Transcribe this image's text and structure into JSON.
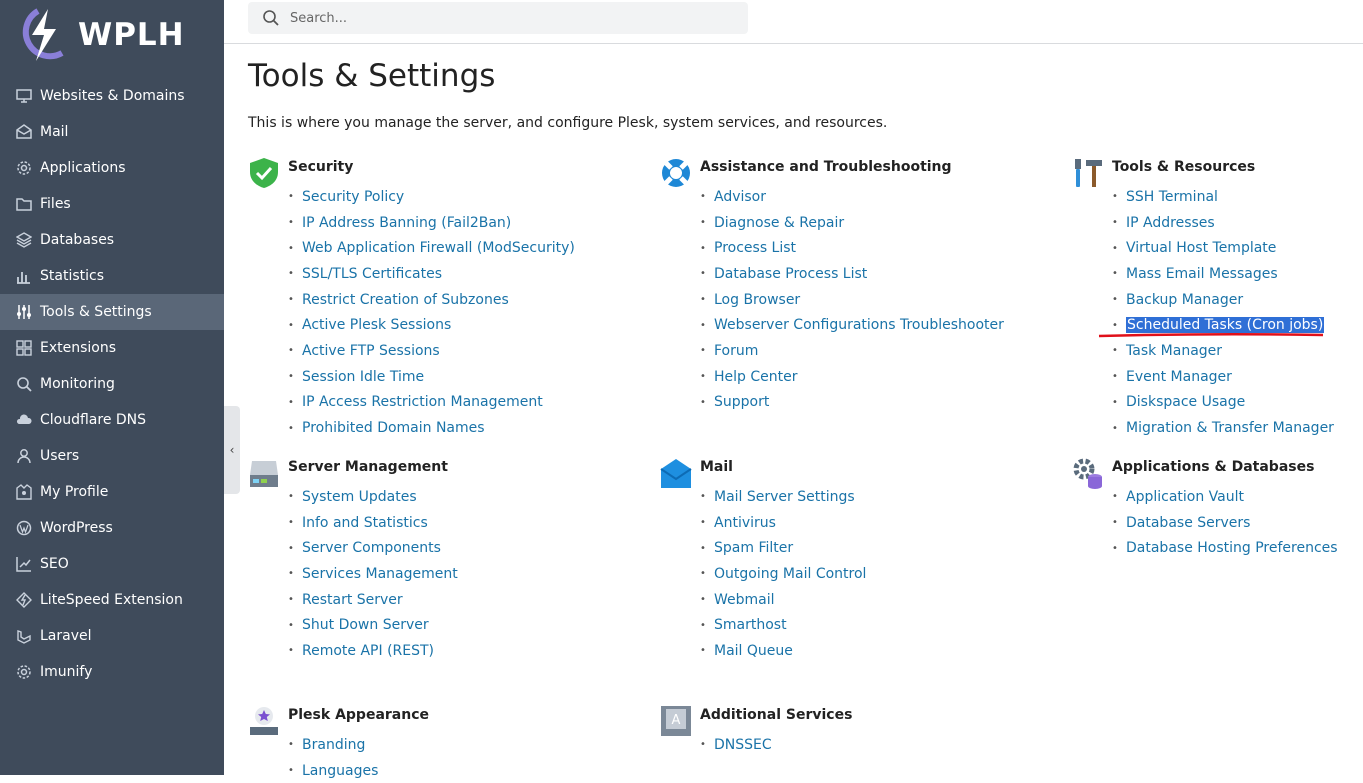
{
  "brand": {
    "name": "WPLH"
  },
  "search": {
    "placeholder": "Search..."
  },
  "sidebar": {
    "items": [
      {
        "label": "Websites & Domains",
        "icon": "monitor-icon"
      },
      {
        "label": "Mail",
        "icon": "mail-icon"
      },
      {
        "label": "Applications",
        "icon": "gear-icon"
      },
      {
        "label": "Files",
        "icon": "folder-icon"
      },
      {
        "label": "Databases",
        "icon": "layers-icon"
      },
      {
        "label": "Statistics",
        "icon": "bar-chart-icon"
      },
      {
        "label": "Tools & Settings",
        "icon": "sliders-icon",
        "active": true
      },
      {
        "label": "Extensions",
        "icon": "grid-icon"
      },
      {
        "label": "Monitoring",
        "icon": "magnifier-icon"
      },
      {
        "label": "Cloudflare DNS",
        "icon": "cloud-icon"
      },
      {
        "label": "Users",
        "icon": "user-icon"
      },
      {
        "label": "My Profile",
        "icon": "profile-icon"
      },
      {
        "label": "WordPress",
        "icon": "wordpress-icon"
      },
      {
        "label": "SEO",
        "icon": "seo-chart-icon"
      },
      {
        "label": "LiteSpeed Extension",
        "icon": "litespeed-icon"
      },
      {
        "label": "Laravel",
        "icon": "laravel-icon"
      },
      {
        "label": "Imunify",
        "icon": "shield-gear-icon"
      }
    ]
  },
  "page": {
    "title": "Tools & Settings",
    "description": "This is where you manage the server, and configure Plesk, system services, and resources."
  },
  "sections": {
    "security": {
      "title": "Security",
      "links": [
        "Security Policy",
        "IP Address Banning (Fail2Ban)",
        "Web Application Firewall (ModSecurity)",
        "SSL/TLS Certificates",
        "Restrict Creation of Subzones",
        "Active Plesk Sessions",
        "Active FTP Sessions",
        "Session Idle Time",
        "IP Access Restriction Management",
        "Prohibited Domain Names"
      ]
    },
    "assistance": {
      "title": "Assistance and Troubleshooting",
      "links": [
        "Advisor",
        "Diagnose & Repair",
        "Process List",
        "Database Process List",
        "Log Browser",
        "Webserver Configurations Troubleshooter",
        "Forum",
        "Help Center",
        "Support"
      ]
    },
    "tools": {
      "title": "Tools & Resources",
      "links": [
        "SSH Terminal",
        "IP Addresses",
        "Virtual Host Template",
        "Mass Email Messages",
        "Backup Manager",
        "Scheduled Tasks (Cron jobs)",
        "Task Manager",
        "Event Manager",
        "Diskspace Usage",
        "Migration & Transfer Manager"
      ],
      "selected": "Scheduled Tasks (Cron jobs)"
    },
    "server": {
      "title": "Server Management",
      "links": [
        "System Updates",
        "Info and Statistics",
        "Server Components",
        "Services Management",
        "Restart Server",
        "Shut Down Server",
        "Remote API (REST)"
      ]
    },
    "mail": {
      "title": "Mail",
      "links": [
        "Mail Server Settings",
        "Antivirus",
        "Spam Filter",
        "Outgoing Mail Control",
        "Webmail",
        "Smarthost",
        "Mail Queue"
      ]
    },
    "appsdb": {
      "title": "Applications & Databases",
      "links": [
        "Application Vault",
        "Database Servers",
        "Database Hosting Preferences"
      ]
    },
    "appearance": {
      "title": "Plesk Appearance",
      "links": [
        "Branding",
        "Languages"
      ]
    },
    "additional": {
      "title": "Additional Services",
      "links": [
        "DNSSEC"
      ]
    }
  },
  "colors": {
    "sidebar_bg": "#3f4b5b",
    "sidebar_active": "#5a6778",
    "link": "#1a73a8",
    "selection": "#2f6fd6",
    "annotation": "#e0101a"
  }
}
